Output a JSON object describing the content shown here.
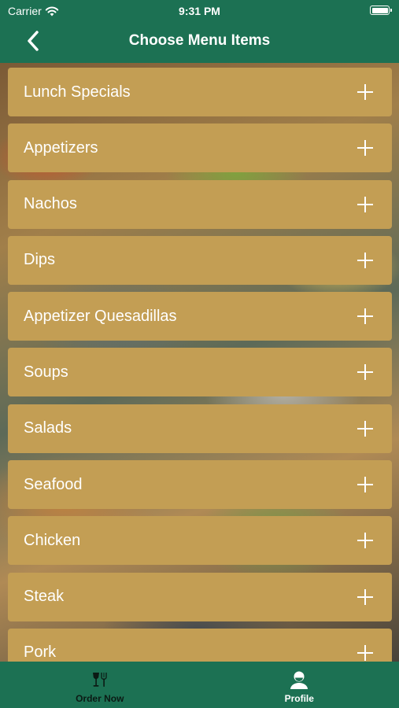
{
  "status_bar": {
    "carrier": "Carrier",
    "time": "9:31 PM"
  },
  "nav": {
    "title": "Choose Menu Items",
    "back_icon": "chevron-left-icon"
  },
  "menu": {
    "items": [
      {
        "label": "Lunch Specials"
      },
      {
        "label": "Appetizers"
      },
      {
        "label": "Nachos"
      },
      {
        "label": "Dips"
      },
      {
        "label": "Appetizer Quesadillas"
      },
      {
        "label": "Soups"
      },
      {
        "label": "Salads"
      },
      {
        "label": "Seafood"
      },
      {
        "label": "Chicken"
      },
      {
        "label": "Steak"
      },
      {
        "label": "Pork"
      }
    ]
  },
  "tab_bar": {
    "tabs": [
      {
        "label": "Order Now",
        "icon": "dining-icon",
        "active": false
      },
      {
        "label": "Profile",
        "icon": "user-icon",
        "active": true
      }
    ]
  },
  "colors": {
    "primary_green": "#1c7153",
    "menu_item_gold": "#c39e54",
    "inactive_tab_text": "#0b1a14",
    "active_tab_text": "#ffffff"
  }
}
